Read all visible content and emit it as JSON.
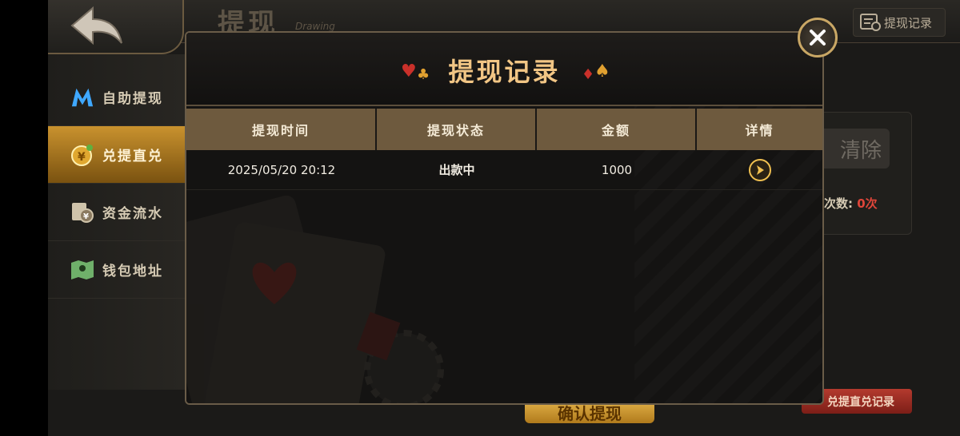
{
  "header": {
    "title": "提现",
    "subtitle": "Drawing",
    "record_button": "提现记录"
  },
  "sidebar": {
    "items": [
      {
        "label": "自助提现",
        "icon": "m-logo-icon",
        "active": false
      },
      {
        "label": "兑提直兑",
        "icon": "coin-icon",
        "active": true
      },
      {
        "label": "资金流水",
        "icon": "ledger-icon",
        "active": false
      },
      {
        "label": "钱包地址",
        "icon": "map-icon",
        "active": false
      }
    ]
  },
  "right_panel": {
    "clear_button": "清除",
    "count_label": "次数:",
    "count_value": "0次"
  },
  "footer": {
    "confirm_button": "确认提现",
    "history_button": "兑提直兑记录"
  },
  "modal": {
    "title": "提现记录",
    "columns": [
      "提现时间",
      "提现状态",
      "金额",
      "详情"
    ],
    "rows": [
      {
        "time": "2025/05/20 20:12",
        "status": "出款中",
        "amount": "1000",
        "detail": "arrow-right-icon"
      }
    ]
  },
  "colors": {
    "accent_gold": "#f2c685",
    "header_brown": "#6e5a3e",
    "count_red": "#e0463a"
  }
}
